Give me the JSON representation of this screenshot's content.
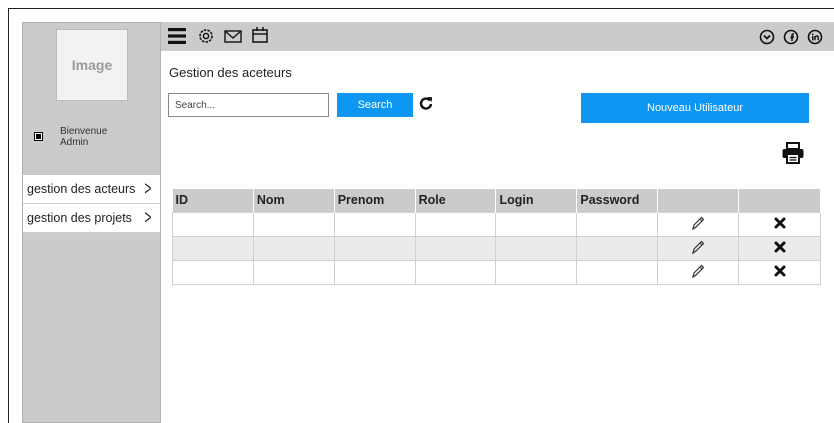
{
  "sidebar": {
    "image_label": "Image",
    "welcome_line1": "Bienvenue",
    "welcome_line2": "Admin",
    "items": [
      {
        "label": "gestion des acteurs"
      },
      {
        "label": "gestion des projets"
      }
    ]
  },
  "topbar": {
    "left_icons": [
      "menu-icon",
      "settings-icon",
      "mail-icon",
      "calendar-icon"
    ],
    "right_icons": [
      "circle-chevron-icon",
      "facebook-icon",
      "linkedin-icon"
    ]
  },
  "main": {
    "title": "Gestion des aceteurs",
    "search": {
      "placeholder": "Search...",
      "button_label": "Search"
    },
    "new_user_label": "Nouveau Utilisateur"
  },
  "table": {
    "columns": [
      "ID",
      "Nom",
      "Prenom",
      "Role",
      "Login",
      "Password",
      "",
      ""
    ],
    "rows": [
      {
        "ID": "",
        "Nom": "",
        "Prenom": "",
        "Role": "",
        "Login": "",
        "Password": ""
      },
      {
        "ID": "",
        "Nom": "",
        "Prenom": "",
        "Role": "",
        "Login": "",
        "Password": ""
      },
      {
        "ID": "",
        "Nom": "",
        "Prenom": "",
        "Role": "",
        "Login": "",
        "Password": ""
      }
    ]
  },
  "colors": {
    "accent": "#0e97f2",
    "panel": "#cbcbcb"
  }
}
